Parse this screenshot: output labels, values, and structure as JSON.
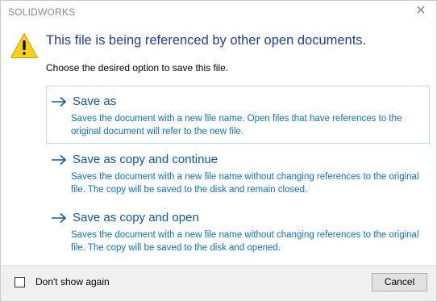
{
  "window": {
    "title": "SOLIDWORKS",
    "close_icon": "close-icon"
  },
  "message": {
    "icon": "warning-icon",
    "instruction": "This file is being referenced by other open documents.",
    "subtext": "Choose the desired option to save this file."
  },
  "options": [
    {
      "label": "Save as",
      "description": "Saves the document with a new file name. Open files that have references to the original document will refer to the new file.",
      "selected": true
    },
    {
      "label": "Save as copy and continue",
      "description": "Saves the document with a new file name without changing references to the original file. The copy will be saved to the disk and remain closed.",
      "selected": false
    },
    {
      "label": "Save as copy and open",
      "description": "Saves the document with a new file name without changing references to the original file. The copy will be saved to the disk and opened.",
      "selected": false
    }
  ],
  "footer": {
    "dont_show_label": "Don't show again",
    "dont_show_checked": false,
    "cancel_label": "Cancel"
  },
  "colors": {
    "instruction": "#1f3f9a",
    "option_label": "#0a58b0",
    "option_desc": "#0b73c9",
    "selected_border": "#bcdcf4",
    "warning_fill": "#fcd116"
  }
}
